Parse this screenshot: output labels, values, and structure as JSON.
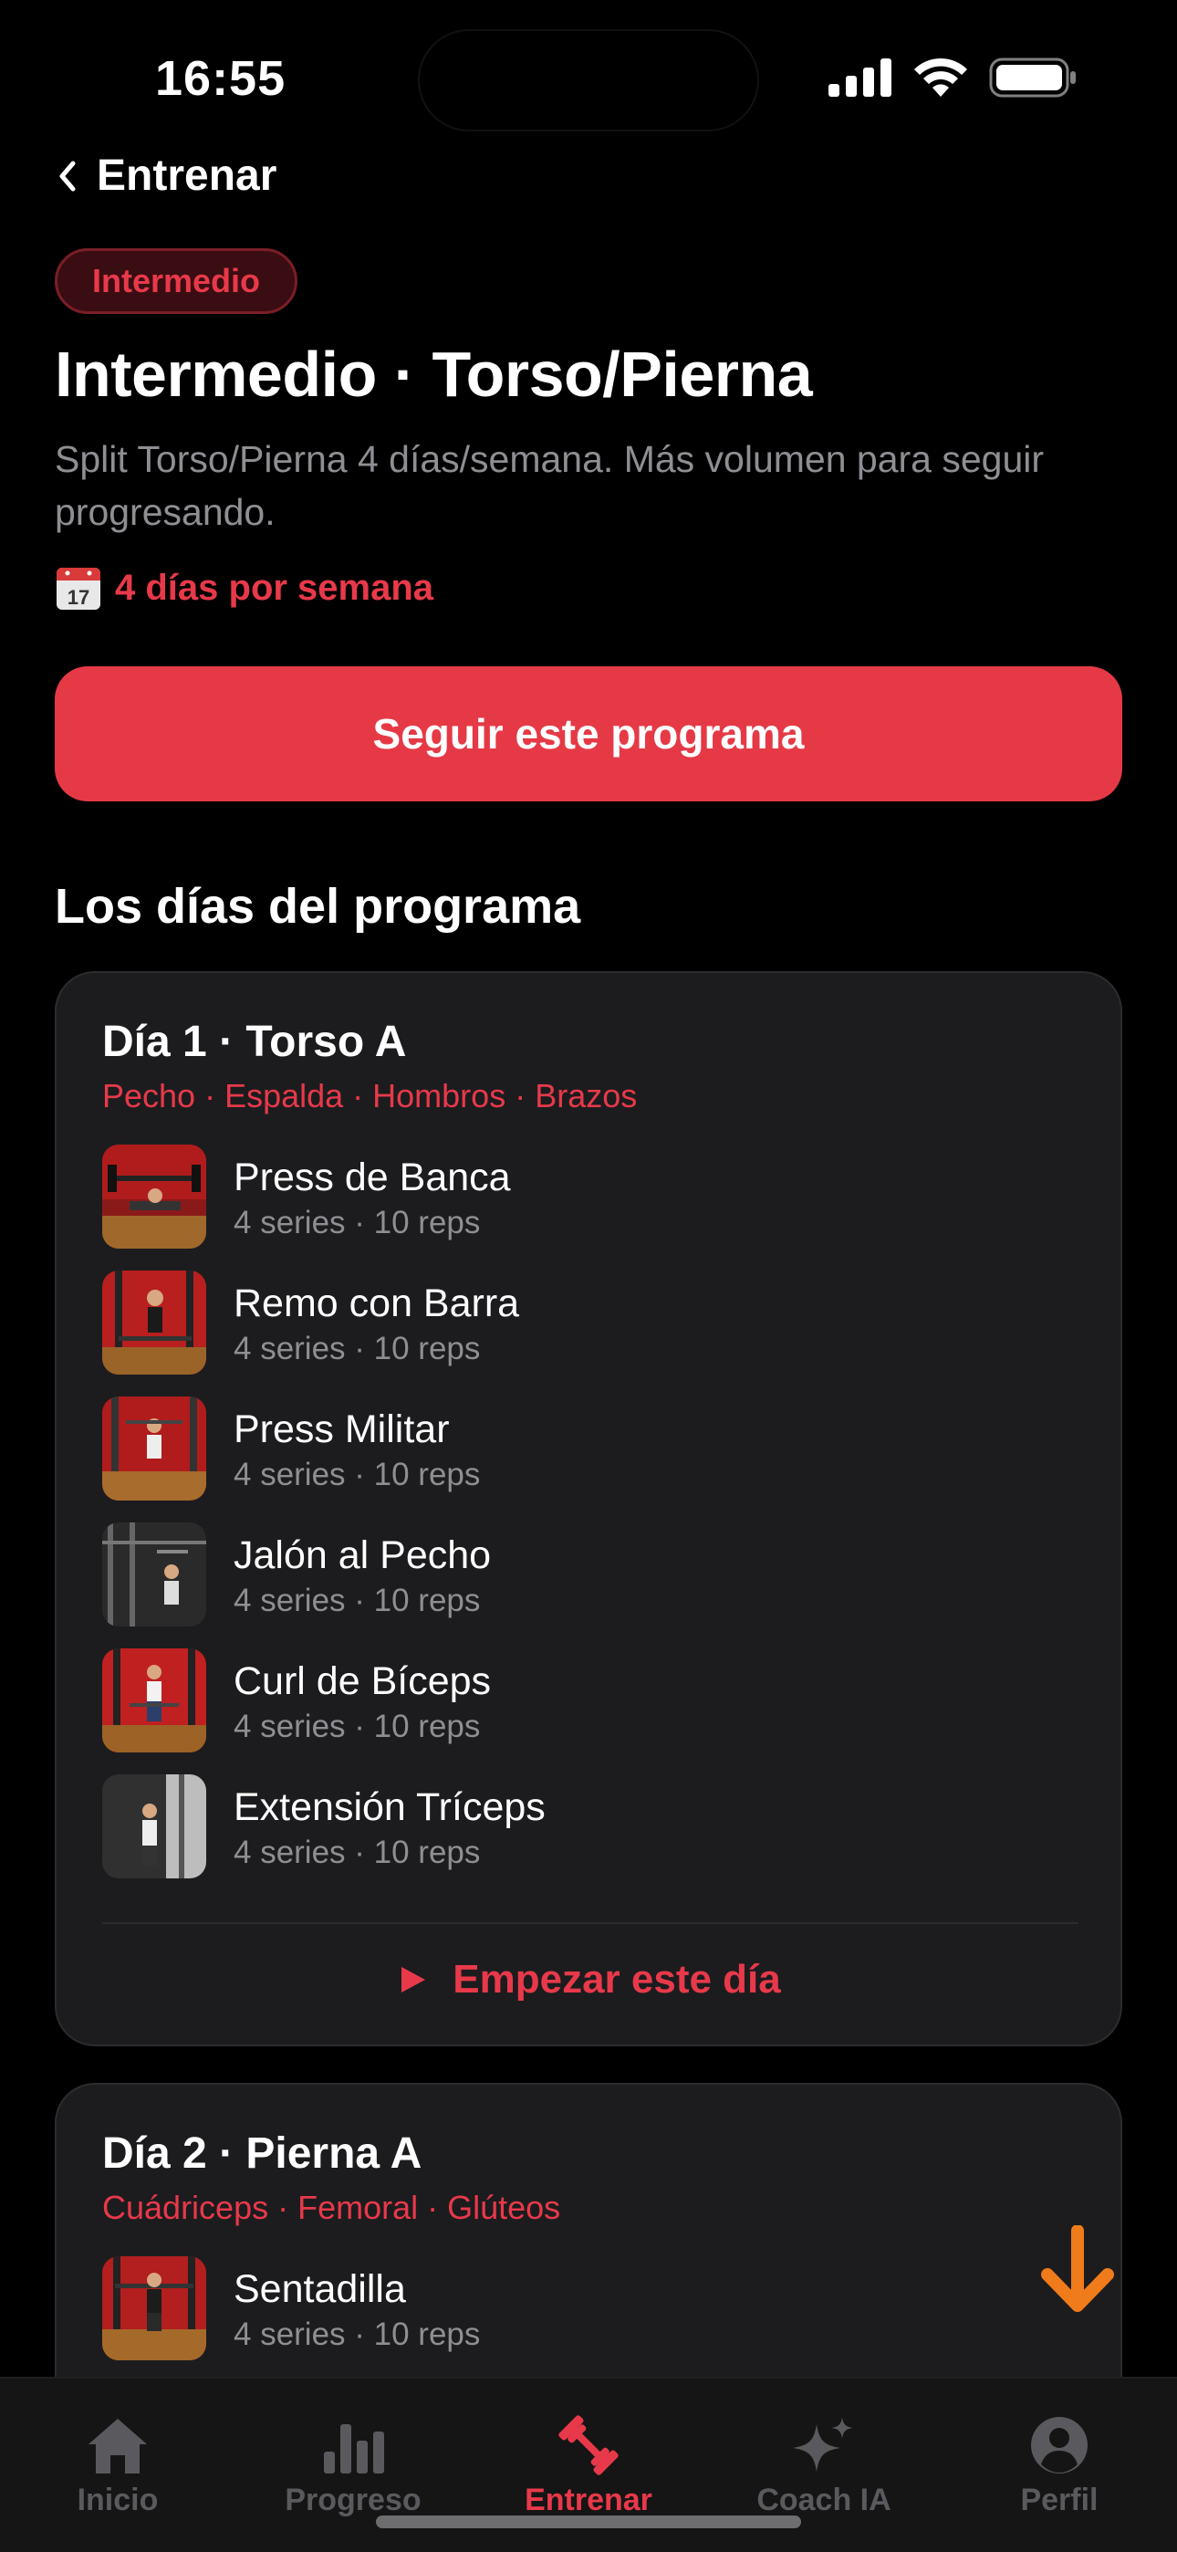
{
  "status_bar": {
    "time": "16:55"
  },
  "header": {
    "back_label": "Entrenar",
    "level_badge": "Intermedio",
    "title": "Intermedio · Torso/Pierna",
    "description": "Split Torso/Pierna 4 días/semana. Más volumen para seguir progresando.",
    "days_per_week": "4 días por semana"
  },
  "follow_button": "Seguir este programa",
  "section_title": "Los días del programa",
  "days": [
    {
      "title": "Día 1 · Torso A",
      "muscles": "Pecho · Espalda · Hombros · Brazos",
      "exercises": [
        {
          "name": "Press de Banca",
          "meta": "4 series · 10 reps"
        },
        {
          "name": "Remo con Barra",
          "meta": "4 series · 10 reps"
        },
        {
          "name": "Press Militar",
          "meta": "4 series · 10 reps"
        },
        {
          "name": "Jalón al Pecho",
          "meta": "4 series · 10 reps"
        },
        {
          "name": "Curl de Bíceps",
          "meta": "4 series · 10 reps"
        },
        {
          "name": "Extensión Tríceps",
          "meta": "4 series · 10 reps"
        }
      ],
      "start_label": "Empezar este día"
    },
    {
      "title": "Día 2 · Pierna A",
      "muscles": "Cuádriceps · Femoral · Glúteos",
      "exercises": [
        {
          "name": "Sentadilla",
          "meta": "4 series · 10 reps"
        }
      ]
    }
  ],
  "tab_bar": {
    "items": [
      {
        "label": "Inicio",
        "icon": "home-icon"
      },
      {
        "label": "Progreso",
        "icon": "bar-chart-icon"
      },
      {
        "label": "Entrenar",
        "icon": "dumbbell-icon",
        "active": true
      },
      {
        "label": "Coach IA",
        "icon": "sparkles-icon"
      },
      {
        "label": "Perfil",
        "icon": "person-icon"
      }
    ]
  },
  "colors": {
    "accent": "#e63946",
    "background": "#000000",
    "card": "#1c1c1e",
    "secondary_text": "#8e8e93",
    "scroll_arrow": "#f07b1a"
  }
}
